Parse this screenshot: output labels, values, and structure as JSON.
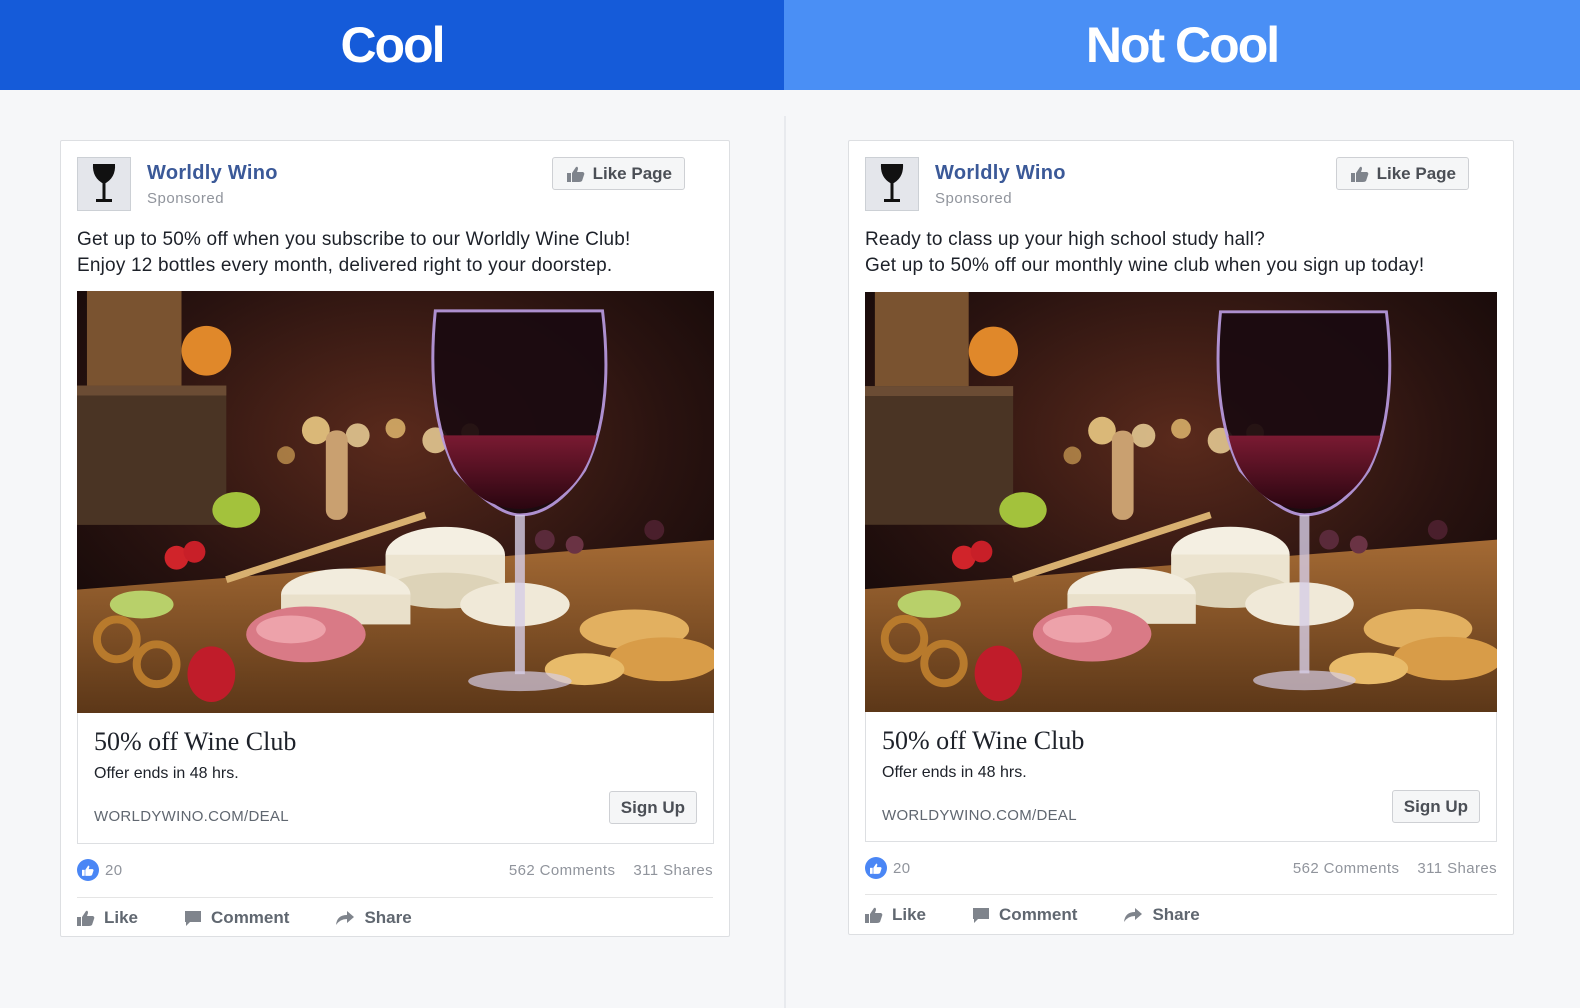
{
  "headers": {
    "left": "Cool",
    "right": "Not Cool"
  },
  "colors": {
    "cool_header": "#155bd9",
    "notcool_header": "#4a8ff5",
    "page_name": "#3b5998",
    "like_blue": "#4a86f5"
  },
  "ads": [
    {
      "page_name": "Worldly Wino",
      "sponsored": "Sponsored",
      "like_page_label": "Like Page",
      "text_line1": "Get up to 50% off when you subscribe to our Worldly Wine Club!",
      "text_line2": "Enjoy 12 bottles every month, delivered right to your doorstep.",
      "image_icon": "wine-glass-charcuterie-photo",
      "link_title": "50% off Wine Club",
      "link_desc": "Offer ends in 48 hrs.",
      "link_domain": "WORLDYWINO.COM/DEAL",
      "cta_label": "Sign Up",
      "reactions": "20",
      "comments": "562 Comments",
      "shares": "311 Shares",
      "action_like": "Like",
      "action_comment": "Comment",
      "action_share": "Share"
    },
    {
      "page_name": "Worldly Wino",
      "sponsored": "Sponsored",
      "like_page_label": "Like Page",
      "text_line1": "Ready to class up your high school study hall?",
      "text_line2": "Get up to 50% off our monthly wine club when you sign up today!",
      "image_icon": "wine-glass-charcuterie-photo",
      "link_title": "50% off Wine Club",
      "link_desc": "Offer ends in 48 hrs.",
      "link_domain": "WORLDYWINO.COM/DEAL",
      "cta_label": "Sign Up",
      "reactions": "20",
      "comments": "562 Comments",
      "shares": "311 Shares",
      "action_like": "Like",
      "action_comment": "Comment",
      "action_share": "Share"
    }
  ]
}
